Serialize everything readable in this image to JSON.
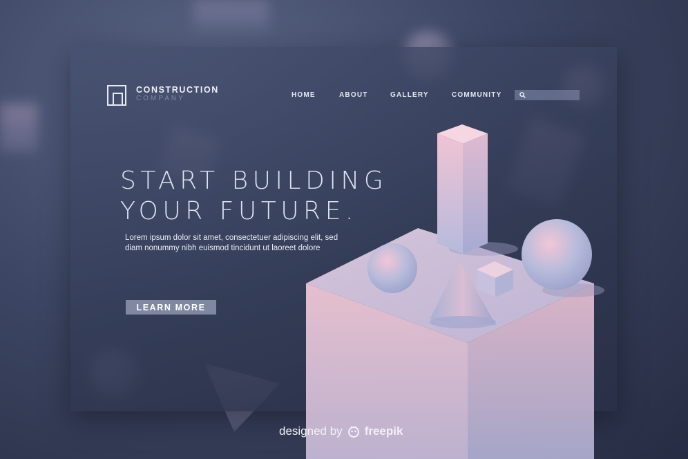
{
  "logo": {
    "title": "CONSTRUCTION",
    "subtitle": "COMPANY"
  },
  "nav": {
    "items": [
      {
        "label": "HOME"
      },
      {
        "label": "ABOUT"
      },
      {
        "label": "GALLERY"
      },
      {
        "label": "COMMUNITY"
      }
    ]
  },
  "search": {
    "placeholder": ""
  },
  "hero": {
    "headline_line1": "START BUILDING",
    "headline_line2": "YOUR FUTURE.",
    "body_line1": "Lorem ipsum dolor sit amet, consectetuer adipiscing elit, sed",
    "body_line2": "diam nonummy nibh euismod tincidunt ut laoreet dolore",
    "button_label": "LEARN MORE"
  },
  "credit": {
    "prefix": "designed by",
    "brand": "freepik"
  },
  "colors": {
    "accent_pink": "#e9b7c9",
    "accent_blue": "#b5c0e0",
    "background": "#2f3652"
  }
}
